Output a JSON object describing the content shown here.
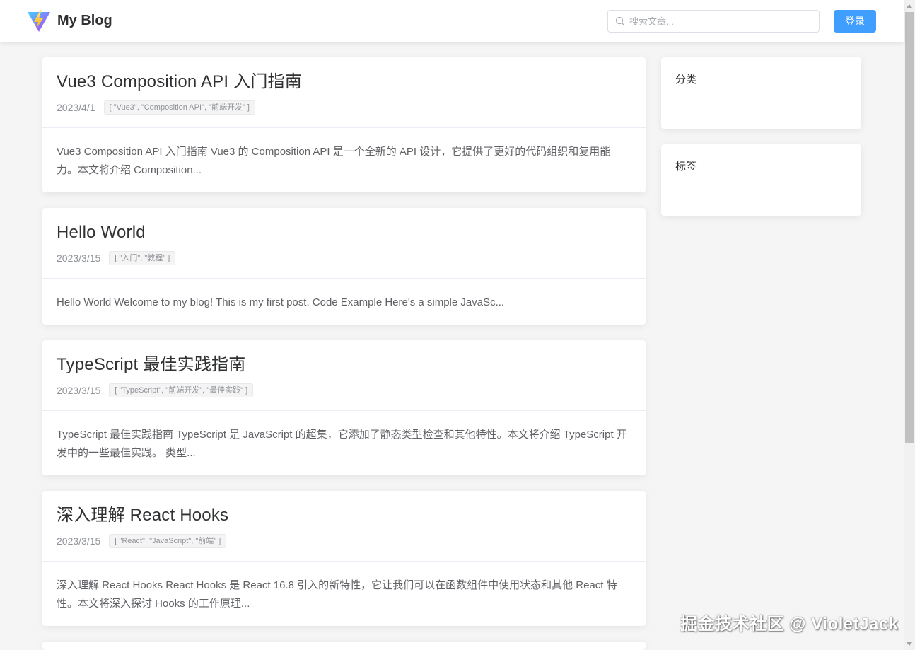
{
  "header": {
    "site_title": "My Blog",
    "search_placeholder": "搜索文章...",
    "login_label": "登录"
  },
  "posts": [
    {
      "title": "Vue3 Composition API 入门指南",
      "date": "2023/4/1",
      "tags": "[ \"Vue3\", \"Composition API\", \"前端开发\" ]",
      "excerpt": "Vue3 Composition API 入门指南 Vue3 的 Composition API 是一个全新的 API 设计，它提供了更好的代码组织和复用能力。本文将介绍 Composition..."
    },
    {
      "title": "Hello World",
      "date": "2023/3/15",
      "tags": "[ \"入门\", \"教程\" ]",
      "excerpt": "Hello World Welcome to my blog! This is my first post. Code Example Here's a simple JavaSc..."
    },
    {
      "title": "TypeScript 最佳实践指南",
      "date": "2023/3/15",
      "tags": "[ \"TypeScript\", \"前端开发\", \"最佳实践\" ]",
      "excerpt": "TypeScript 最佳实践指南 TypeScript 是 JavaScript 的超集，它添加了静态类型检查和其他特性。本文将介绍 TypeScript 开发中的一些最佳实践。 类型..."
    },
    {
      "title": "深入理解 React Hooks",
      "date": "2023/3/15",
      "tags": "[ \"React\", \"JavaScript\", \"前端\" ]",
      "excerpt": "深入理解 React Hooks React Hooks 是 React 16.8 引入的新特性，它让我们可以在函数组件中使用状态和其他 React 特性。本文将深入探讨 Hooks 的工作原理..."
    }
  ],
  "sidebar": {
    "categories_title": "分类",
    "tags_title": "标签"
  },
  "watermark": "掘金技术社区 @ VioletJack",
  "colors": {
    "primary": "#409eff",
    "background": "#f5f5f5",
    "card": "#ffffff",
    "text": "#303133",
    "muted": "#909399"
  }
}
